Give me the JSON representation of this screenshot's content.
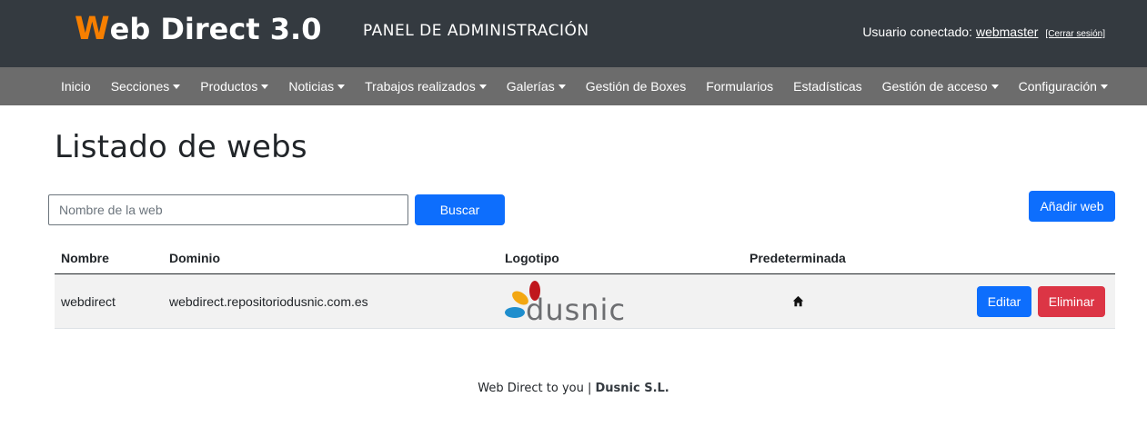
{
  "header": {
    "brand_initial": "W",
    "brand_rest": "eb Direct 3.0",
    "subtitle": "PANEL DE ADMINISTRACIÓN",
    "user_label": "Usuario conectado:",
    "user_name": "webmaster",
    "logout_label": "[Cerrar sesión]",
    "brand_accent_color": "#f77f00",
    "background_color": "#343a40"
  },
  "nav": {
    "background_color": "#6c6c6c",
    "items": [
      {
        "label": "Inicio",
        "dropdown": false
      },
      {
        "label": "Secciones",
        "dropdown": true
      },
      {
        "label": "Productos",
        "dropdown": true
      },
      {
        "label": "Noticias",
        "dropdown": true
      },
      {
        "label": "Trabajos realizados",
        "dropdown": true
      },
      {
        "label": "Galerías",
        "dropdown": true
      },
      {
        "label": "Gestión de Boxes",
        "dropdown": false
      },
      {
        "label": "Formularios",
        "dropdown": false
      },
      {
        "label": "Estadísticas",
        "dropdown": false
      },
      {
        "label": "Gestión de acceso",
        "dropdown": true
      },
      {
        "label": "Configuración",
        "dropdown": true
      }
    ]
  },
  "main": {
    "title": "Listado de webs",
    "search": {
      "placeholder": "Nombre de la web",
      "value": "",
      "button_label": "Buscar"
    },
    "add_button_label": "Añadir web",
    "table": {
      "headers": [
        "Nombre",
        "Dominio",
        "Logotipo",
        "Predeterminada"
      ],
      "rows": [
        {
          "name": "webdirect",
          "domain": "webdirect.repositoriodusnic.com.es",
          "logo_text": "dusnic",
          "default_icon": "home-icon",
          "edit_label": "Editar",
          "delete_label": "Eliminar"
        }
      ]
    }
  },
  "footer": {
    "text": "Web Direct to you | ",
    "company": "Dusnic S.L."
  },
  "colors": {
    "primary": "#0d6efd",
    "danger": "#dc3545",
    "row_background": "#f2f2f2"
  }
}
